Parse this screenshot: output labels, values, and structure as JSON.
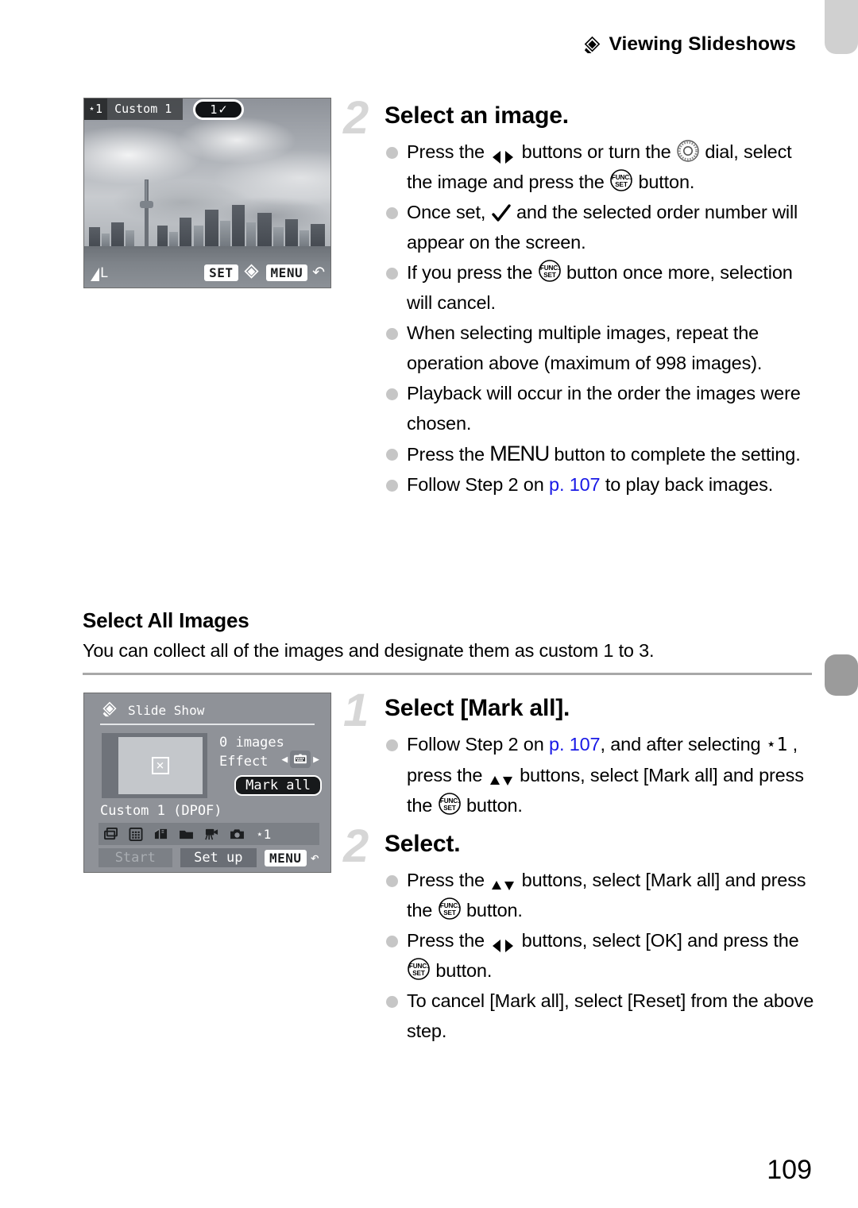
{
  "header": {
    "icon": "slideshow-diamond-icon",
    "title": "Viewing Slideshows"
  },
  "tabs": {
    "top_tab": "chapter-tab",
    "section_tab": "section-tab"
  },
  "lcd_photo": {
    "name": "image-selection-screen",
    "star_badge": "⋆1",
    "title": "Custom 1",
    "order_number": "1",
    "order_check": "✓",
    "quality_label": "L",
    "set_key": "SET",
    "menu_key": "MENU",
    "back_arrow": "↶",
    "scene": "toronto-skyline-photo"
  },
  "lcd_menu": {
    "name": "slide-show-menu-screen",
    "title": "Slide Show",
    "images_count": "0 images",
    "effect_label": "Effect",
    "mark_all_chip": "Mark all",
    "custom_label": "Custom 1 (DPOF)",
    "thumb_placeholder": "×",
    "arrow_left": "◀",
    "arrow_right": "▶",
    "strip_icons": [
      "multiple-images-icon",
      "grid-images-icon",
      "folder-stack-icon",
      "folder-icon",
      "movie-camera-icon",
      "still-camera-icon"
    ],
    "strip_star": "⋆1",
    "start_button": "Start",
    "setup_button": "Set up",
    "menu_key": "MENU",
    "back_arrow": "↶"
  },
  "steps": [
    {
      "number": "2",
      "title": "Select an image.",
      "bullets": [
        {
          "parts": [
            {
              "t": "text",
              "v": "Press the "
            },
            {
              "t": "icon",
              "v": "left-right-buttons-icon"
            },
            {
              "t": "text",
              "v": " buttons or turn the "
            },
            {
              "t": "icon",
              "v": "control-dial-icon"
            },
            {
              "t": "text",
              "v": " dial, select the image and press the "
            },
            {
              "t": "icon",
              "v": "func-set-button-icon"
            },
            {
              "t": "text",
              "v": " button."
            }
          ]
        },
        {
          "parts": [
            {
              "t": "text",
              "v": "Once set, "
            },
            {
              "t": "icon",
              "v": "checkmark-icon"
            },
            {
              "t": "text",
              "v": " and the selected order number will appear on the screen."
            }
          ]
        },
        {
          "parts": [
            {
              "t": "text",
              "v": "If you press the "
            },
            {
              "t": "icon",
              "v": "func-set-button-icon"
            },
            {
              "t": "text",
              "v": " button once more, selection will cancel."
            }
          ]
        },
        {
          "parts": [
            {
              "t": "text",
              "v": "When selecting multiple images, repeat the operation above (maximum of 998 images)."
            }
          ]
        },
        {
          "parts": [
            {
              "t": "text",
              "v": "Playback will occur in the order the images were chosen."
            }
          ]
        },
        {
          "parts": [
            {
              "t": "text",
              "v": "Press the "
            },
            {
              "t": "icon",
              "v": "menu-button-icon"
            },
            {
              "t": "text",
              "v": " button to complete the setting."
            }
          ]
        },
        {
          "parts": [
            {
              "t": "text",
              "v": "Follow Step 2 on "
            },
            {
              "t": "link",
              "v": "p. 107"
            },
            {
              "t": "text",
              "v": " to play back images."
            }
          ]
        }
      ]
    },
    {
      "number": "1",
      "title": "Select [Mark all].",
      "bullets": [
        {
          "parts": [
            {
              "t": "text",
              "v": "Follow Step 2 on "
            },
            {
              "t": "link",
              "v": "p. 107"
            },
            {
              "t": "text",
              "v": ", and after selecting "
            },
            {
              "t": "icon",
              "v": "star-one-icon"
            },
            {
              "t": "text",
              "v": " , press the "
            },
            {
              "t": "icon",
              "v": "up-down-buttons-icon"
            },
            {
              "t": "text",
              "v": " buttons, select [Mark all] and press the "
            },
            {
              "t": "icon",
              "v": "func-set-button-icon"
            },
            {
              "t": "text",
              "v": " button."
            }
          ]
        }
      ]
    },
    {
      "number": "2",
      "title": "Select.",
      "bullets": [
        {
          "parts": [
            {
              "t": "text",
              "v": "Press the "
            },
            {
              "t": "icon",
              "v": "up-down-buttons-icon"
            },
            {
              "t": "text",
              "v": " buttons, select [Mark all] and press the "
            },
            {
              "t": "icon",
              "v": "func-set-button-icon"
            },
            {
              "t": "text",
              "v": " button."
            }
          ]
        },
        {
          "parts": [
            {
              "t": "text",
              "v": "Press the "
            },
            {
              "t": "icon",
              "v": "left-right-buttons-icon"
            },
            {
              "t": "text",
              "v": " buttons, select [OK] and press the "
            },
            {
              "t": "icon",
              "v": "func-set-button-icon"
            },
            {
              "t": "text",
              "v": " button."
            }
          ]
        },
        {
          "parts": [
            {
              "t": "text",
              "v": "To cancel [Mark all], select [Reset] from the above step."
            }
          ]
        }
      ]
    }
  ],
  "subsection": {
    "heading": "Select All Images",
    "body": "You can collect all of the images and designate them as custom 1 to 3."
  },
  "footer": {
    "page_number": "109"
  },
  "colors": {
    "link": "#1919e6",
    "bullet": "#c6c6c6",
    "step_number": "#d6d6d6",
    "rule": "#a8a8a8",
    "tab_top": "#d0d0d0",
    "tab_section": "#9b9b9b"
  }
}
